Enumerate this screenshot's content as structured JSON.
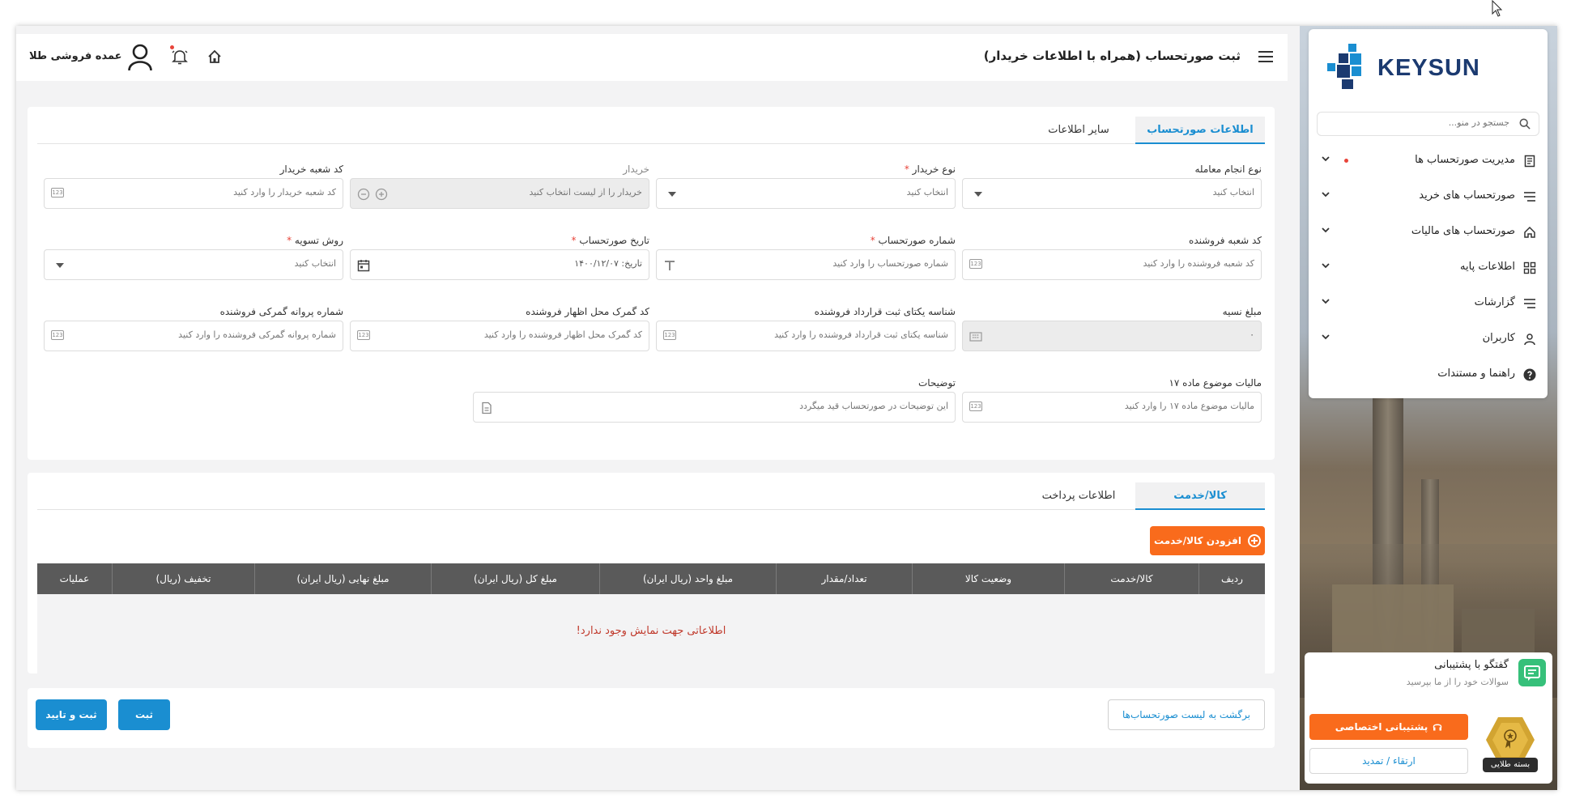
{
  "header": {
    "title": "ثبت صورتحساب (همراه با اطلاعات خریدار)",
    "user_name": "عمده فروشی طلا"
  },
  "sidebar": {
    "brand": "KEYSUN",
    "search_placeholder": "جستجو در منو...",
    "items": [
      {
        "label": "مدیریت صورتحساب ها",
        "icon": "invoice-icon"
      },
      {
        "label": "صورتحساب های خرید",
        "icon": "list-icon"
      },
      {
        "label": "صورتحساب های مالیات",
        "icon": "home-icon"
      },
      {
        "label": "اطلاعات پایه",
        "icon": "grid-icon"
      },
      {
        "label": "گزارشات",
        "icon": "list-icon"
      },
      {
        "label": "کاربران",
        "icon": "user-icon"
      },
      {
        "label": "راهنما و مستندات",
        "icon": "help-icon"
      }
    ],
    "chat": {
      "title": "گفتگو با پشتیبانی",
      "subtitle": "سوالات خود را از ما بپرسید"
    },
    "package": {
      "badge_label": "بسته طلایی",
      "support_button": "پشتیبانی اختصاصی",
      "upgrade_button": "ارتقاء / تمدید"
    }
  },
  "form": {
    "tabs": [
      "اطلاعات صورتحساب",
      "سایر اطلاعات"
    ],
    "fields": {
      "transaction_type": {
        "label": "نوع انجام معامله",
        "placeholder": "انتخاب کنید"
      },
      "buyer_type": {
        "label": "نوع خریدار",
        "placeholder": "انتخاب کنید"
      },
      "buyer": {
        "label": "خریدار",
        "placeholder": "خریدار را از لیست انتخاب کنید"
      },
      "buyer_branch": {
        "label": "کد شعبه خریدار",
        "placeholder": "کد شعبه خریدار را وارد کنید"
      },
      "seller_branch": {
        "label": "کد شعبه فروشنده",
        "placeholder": "کد شعبه فروشنده را وارد کنید"
      },
      "invoice_number": {
        "label": "شماره صورتحساب",
        "placeholder": "شماره صورتحساب را وارد کنید"
      },
      "invoice_date": {
        "label": "تاریخ صورتحساب",
        "value": "تاریخ: ۱۴۰۰/۱۲/۰۷"
      },
      "settlement": {
        "label": "روش تسویه",
        "placeholder": "انتخاب کنید"
      },
      "credit_amount": {
        "label": "مبلغ نسیه",
        "value": "۰"
      },
      "contract_id": {
        "label": "شناسه یکتای ثبت قرارداد فروشنده",
        "placeholder": "شناسه یکتای ثبت قرارداد فروشنده را وارد کنید"
      },
      "customs_code": {
        "label": "کد گمرک محل اظهار فروشنده",
        "placeholder": "کد گمرک محل اظهار فروشنده را وارد کنید"
      },
      "customs_license": {
        "label": "شماره پروانه گمرکی فروشنده",
        "placeholder": "شماره پروانه گمرکی فروشنده را وارد کنید"
      },
      "tax_17": {
        "label": "مالیات موضوع ماده ۱۷",
        "placeholder": "مالیات موضوع ماده ۱۷ را وارد کنید"
      },
      "description": {
        "label": "توضیحات",
        "placeholder": "این توضیحات در صورتحساب قید میگردد"
      }
    }
  },
  "items": {
    "tabs": [
      "کالا/خدمت",
      "اطلاعات پرداخت"
    ],
    "add_button": "افزودن کالا/خدمت",
    "columns": [
      "ردیف",
      "کالا/خدمت",
      "وضعیت کالا",
      "تعداد/مقدار",
      "مبلغ واحد (ریال ایران)",
      "مبلغ کل (ریال ایران)",
      "مبلغ نهایی (ریال ایران)",
      "تخفیف (ریال)",
      "عملیات"
    ],
    "empty_message": "اطلاعاتی جهت نمایش وجود ندارد!"
  },
  "actions": {
    "back": "برگشت به لیست صورتحساب‌ها",
    "save": "ثبت",
    "save_confirm": "ثبت و تایید"
  },
  "colors": {
    "accent": "#1a8ed1",
    "orange": "#f96b1c",
    "required": "#e8443a",
    "table_header": "#5a5a5a"
  }
}
